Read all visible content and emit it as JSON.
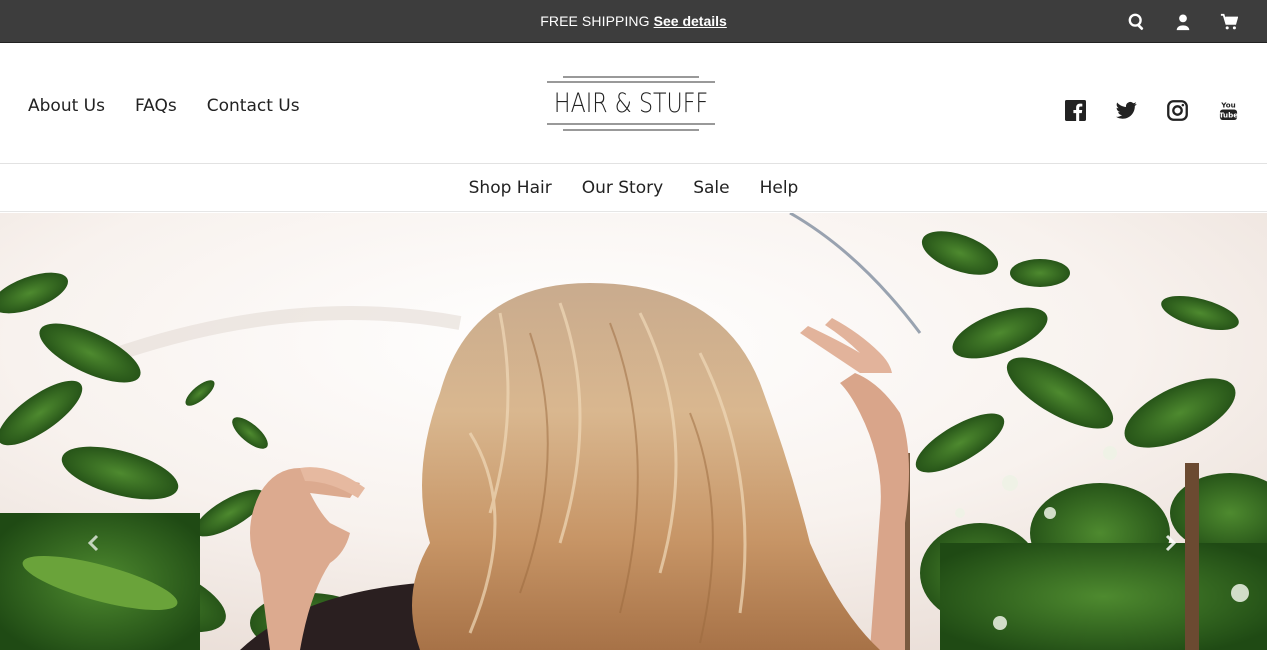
{
  "announcement": {
    "text": "FREE SHIPPING",
    "link_label": "See details"
  },
  "utility_icons": [
    "search-icon",
    "account-icon",
    "cart-icon"
  ],
  "top_links": [
    {
      "label": "About Us"
    },
    {
      "label": "FAQs"
    },
    {
      "label": "Contact Us"
    }
  ],
  "logo": {
    "text": "HAIR & STUFF"
  },
  "social_icons": [
    "facebook-icon",
    "twitter-icon",
    "instagram-icon",
    "youtube-icon"
  ],
  "main_nav": [
    {
      "label": "Shop Hair"
    },
    {
      "label": "Our Story"
    },
    {
      "label": "Sale"
    },
    {
      "label": "Help"
    }
  ],
  "hero": {
    "image_subject": "woman-with-wavy-blonde-hair-among-plants",
    "arrows": [
      "slide-prev-icon",
      "slide-next-icon"
    ]
  },
  "colors": {
    "announcement_bg": "#3d3d3d",
    "text": "#222222",
    "border": "#e2e2e2"
  }
}
